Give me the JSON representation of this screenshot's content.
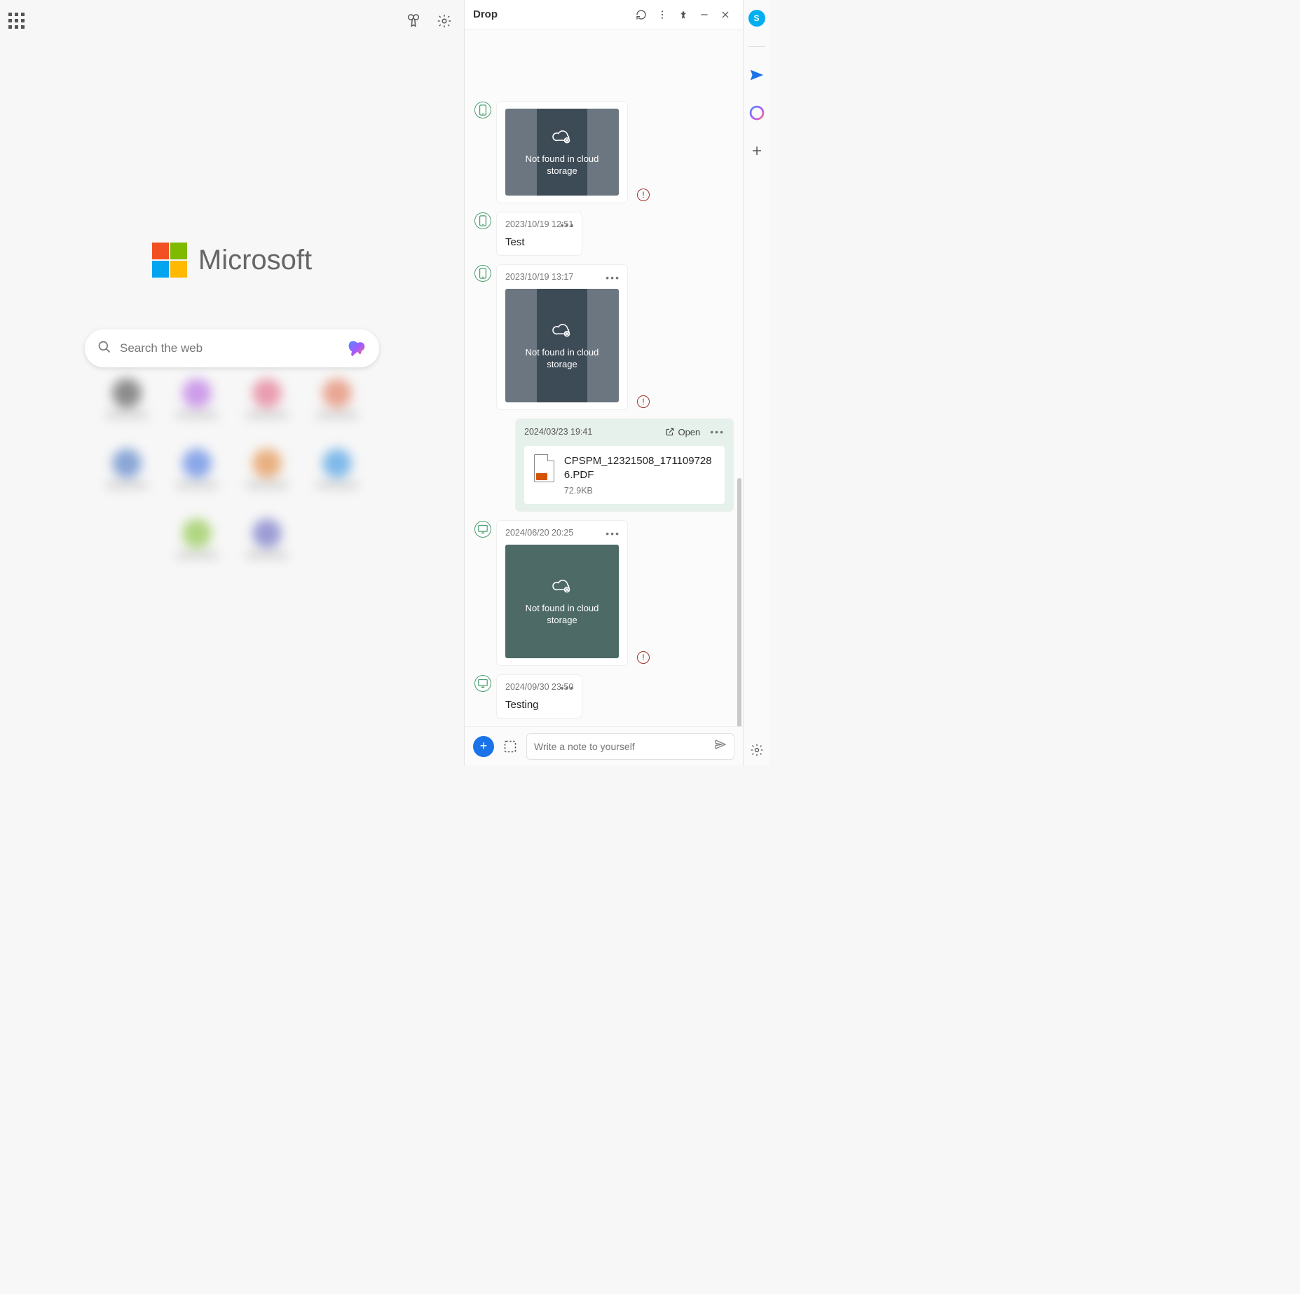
{
  "main": {
    "brand": "Microsoft",
    "search_placeholder": "Search the web"
  },
  "drop": {
    "title": "Drop",
    "not_found_text": "Not found in cloud storage",
    "open_label": "Open",
    "compose_placeholder": "Write a note to yourself",
    "items": [
      {
        "kind": "thumb_cut",
        "device": "phone"
      },
      {
        "kind": "text",
        "device": "phone",
        "ts": "2023/10/19 12:51",
        "text": "Test"
      },
      {
        "kind": "thumb",
        "device": "phone",
        "ts": "2023/10/19 13:17"
      },
      {
        "kind": "file",
        "device": "self",
        "ts": "2024/03/23 19:41",
        "filename": "CPSPM_12321508_1711097286.PDF",
        "filesize": "72.9KB"
      },
      {
        "kind": "thumb",
        "device": "desktop",
        "ts": "2024/06/20 20:25",
        "greenish": true
      },
      {
        "kind": "text",
        "device": "desktop",
        "ts": "2024/09/30 23:50",
        "text": "Testing"
      }
    ]
  },
  "tiles_colors": [
    "#444",
    "#b060e0",
    "#e06080",
    "#e07050",
    "#4070c0",
    "#4070e0",
    "#e08030",
    "#3090e0",
    "#80c030",
    "#6060c0"
  ]
}
